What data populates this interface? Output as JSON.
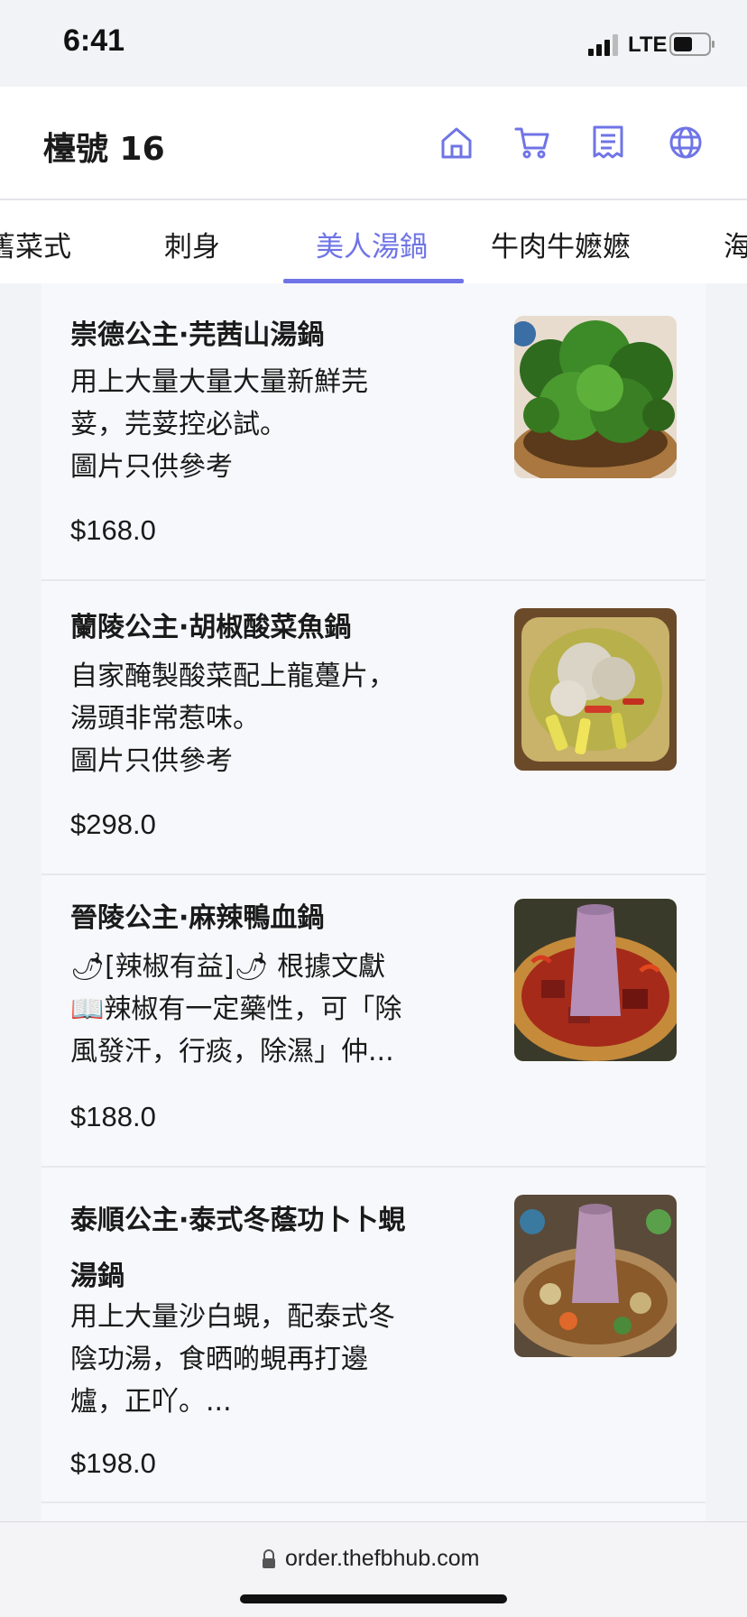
{
  "status_bar": {
    "time": "6:41",
    "network": "LTE"
  },
  "header": {
    "title": "檯號 16"
  },
  "tabs": [
    {
      "label": "舊菜式"
    },
    {
      "label": "刺身"
    },
    {
      "label": "美人湯鍋"
    },
    {
      "label": "牛肉牛嬷嬷"
    },
    {
      "label": "海"
    }
  ],
  "items": [
    {
      "name": "崇德公主·芫茜山湯鍋",
      "desc": "用上大量大量大量新鮮芫\n荽，芫荽控必試。\n圖片只供參考",
      "price": "$168.0"
    },
    {
      "name": "蘭陵公主·胡椒酸菜魚鍋",
      "desc": "自家醃製酸菜配上龍躉片，\n湯頭非常惹味。\n圖片只供參考",
      "price": "$298.0"
    },
    {
      "name": "晉陵公主·麻辣鴨血鍋",
      "desc": "🌶[辣椒有益]🌶 根據文獻\n📖辣椒有一定藥性，可「除\n風發汗，行痰，除濕」仲...",
      "price": "$188.0"
    },
    {
      "name": "泰順公主·泰式冬蔭功卜卜蜆\n湯鍋",
      "desc": "用上大量沙白蜆，配泰式冬\n陰功湯，食晒啲蜆再打邊\n爐，正吖。...",
      "price": "$198.0"
    }
  ],
  "browser": {
    "url": "order.thefbhub.com"
  },
  "colors": {
    "accent": "#6f74e6",
    "background": "#f2f3f7"
  }
}
